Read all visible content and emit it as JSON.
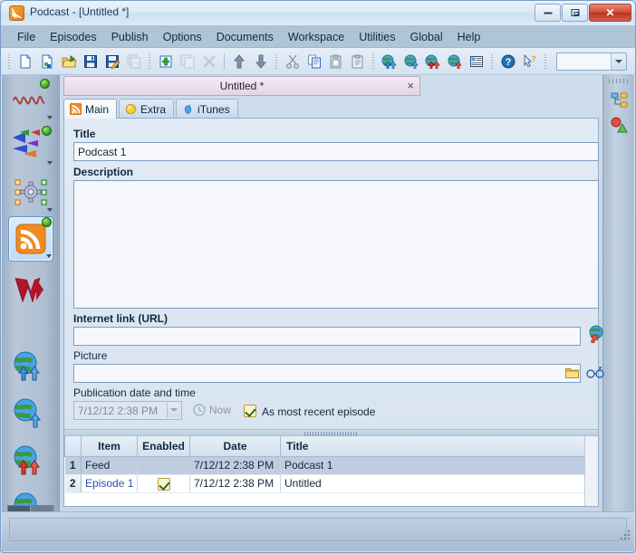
{
  "window": {
    "title": "Podcast - [Untitled *]",
    "app_icon": "rss-icon",
    "controls": {
      "minimize": "minimize-button",
      "maximize": "maximize-button",
      "close": "close-button"
    }
  },
  "menubar": {
    "items": [
      {
        "label": "File"
      },
      {
        "label": "Episodes"
      },
      {
        "label": "Publish"
      },
      {
        "label": "Options"
      },
      {
        "label": "Documents"
      },
      {
        "label": "Workspace"
      },
      {
        "label": "Utilities"
      },
      {
        "label": "Global"
      },
      {
        "label": "Help"
      }
    ]
  },
  "toolbar": {
    "buttons": [
      {
        "name": "new-document-icon",
        "enabled": true
      },
      {
        "name": "new-from-template-icon",
        "enabled": true
      },
      {
        "name": "open-folder-icon",
        "enabled": true
      },
      {
        "name": "save-icon",
        "enabled": true
      },
      {
        "name": "save-as-icon",
        "enabled": true
      },
      {
        "name": "save-all-icon",
        "enabled": false
      },
      {
        "name": "add-item-icon",
        "enabled": true
      },
      {
        "name": "duplicate-item-icon",
        "enabled": false
      },
      {
        "name": "delete-item-icon",
        "enabled": false
      },
      {
        "name": "move-up-icon",
        "enabled": true
      },
      {
        "name": "move-down-icon",
        "enabled": true
      },
      {
        "name": "cut-icon",
        "enabled": true
      },
      {
        "name": "copy-icon",
        "enabled": true
      },
      {
        "name": "paste-icon",
        "enabled": true
      },
      {
        "name": "paste-special-icon",
        "enabled": true
      },
      {
        "name": "upload-all-globe-icon",
        "enabled": true
      },
      {
        "name": "upload-globe-icon",
        "enabled": true
      },
      {
        "name": "publish-all-globe-icon",
        "enabled": true
      },
      {
        "name": "publish-globe-icon",
        "enabled": true
      },
      {
        "name": "properties-icon",
        "enabled": true
      },
      {
        "name": "help-icon",
        "enabled": true
      },
      {
        "name": "context-help-icon",
        "enabled": true
      }
    ],
    "combo": {
      "name": "toolbar-combo",
      "value": "",
      "placeholder": ""
    }
  },
  "sidebar": {
    "items": [
      {
        "name": "sidebar-item-waveform",
        "icon": "waveform-icon",
        "badge": true,
        "dropdown": true,
        "selected": false
      },
      {
        "name": "sidebar-item-markers",
        "icon": "arrows-icon",
        "badge": true,
        "dropdown": true,
        "selected": false
      },
      {
        "name": "sidebar-item-settings",
        "icon": "gear-selection-icon",
        "badge": false,
        "dropdown": true,
        "selected": false
      },
      {
        "name": "sidebar-item-podcast",
        "icon": "rss-icon",
        "badge": true,
        "dropdown": true,
        "selected": true
      },
      {
        "name": "sidebar-item-wavepad",
        "icon": "w-logo-icon",
        "badge": false,
        "dropdown": false,
        "selected": false
      },
      {
        "name": "sidebar-item-upload-all",
        "icon": "globe-double-blue-arrow-icon",
        "badge": false,
        "dropdown": false,
        "selected": false
      },
      {
        "name": "sidebar-item-upload",
        "icon": "globe-blue-arrow-icon",
        "badge": false,
        "dropdown": false,
        "selected": false
      },
      {
        "name": "sidebar-item-publish-all",
        "icon": "globe-double-red-arrow-icon",
        "badge": false,
        "dropdown": false,
        "selected": false
      },
      {
        "name": "sidebar-item-publish",
        "icon": "globe-red-arrow-icon",
        "badge": false,
        "dropdown": false,
        "selected": false
      }
    ]
  },
  "rightbar": {
    "items": [
      {
        "name": "rightbar-item-tree",
        "icon": "tree-structure-icon"
      },
      {
        "name": "rightbar-item-shapes",
        "icon": "shapes-icon"
      }
    ]
  },
  "document": {
    "tab_label": "Untitled *",
    "close_glyph": "×"
  },
  "tabs": [
    {
      "label": "Main",
      "icon": "rss-icon",
      "active": true
    },
    {
      "label": "Extra",
      "icon": "yellow-circle-icon",
      "active": false
    },
    {
      "label": "iTunes",
      "icon": "apple-icon",
      "active": false
    }
  ],
  "form": {
    "title": {
      "label": "Title",
      "value": "Podcast 1",
      "placeholder": ""
    },
    "description": {
      "label": "Description",
      "value": "",
      "placeholder": ""
    },
    "internet_link": {
      "label": "Internet link (URL)",
      "value": "",
      "placeholder": "",
      "button_icon": "globe-red-arrow-icon"
    },
    "picture": {
      "label": "Picture",
      "value": "",
      "placeholder": "",
      "browse_icon": "folder-icon",
      "preview_icon": "glasses-icon"
    },
    "publication": {
      "label": "Publication date and time",
      "value": "7/12/12 2:38 PM",
      "disabled": true,
      "now_button": {
        "label": "Now",
        "icon": "clock-icon",
        "enabled": false
      },
      "checkbox": {
        "label": "As most recent episode",
        "checked": true
      }
    }
  },
  "grid": {
    "columns": [
      "",
      "Item",
      "Enabled",
      "Date",
      "Title"
    ],
    "rows": [
      {
        "num": "1",
        "item": "Feed",
        "enabled": false,
        "date": "7/12/12 2:38 PM",
        "title": "Podcast 1",
        "selected": true,
        "link": false
      },
      {
        "num": "2",
        "item": "Episode 1",
        "enabled": true,
        "date": "7/12/12 2:38 PM",
        "title": "Untitled",
        "selected": false,
        "link": true
      }
    ]
  },
  "statusbar": {
    "text": ""
  },
  "colors": {
    "accent": "#2f4fb0",
    "selection": "#bfcde0",
    "menubar": "#b0c4d8",
    "title_text": "#1b3a5c",
    "rss_orange": "#e8801a",
    "close_red": "#c0392b"
  }
}
